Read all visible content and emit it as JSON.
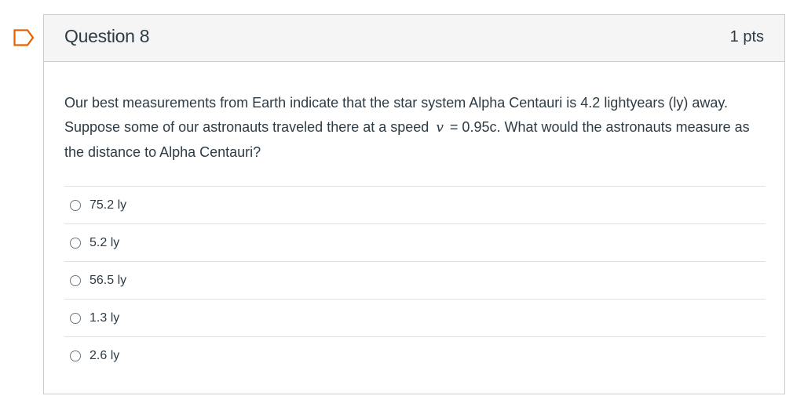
{
  "question": {
    "title": "Question 8",
    "points": "1 pts",
    "text_part1": "Our best measurements from Earth indicate that the star system Alpha Centauri is 4.2 lightyears (ly) away. Suppose some of our astronauts traveled there at a speed",
    "variable": "v",
    "text_part2": "= 0.95c. What would the astronauts measure as the distance to Alpha Centauri?",
    "flag_icon": "flag-bookmark-icon",
    "answers": [
      {
        "label": "75.2 ly",
        "selected": false
      },
      {
        "label": "5.2 ly",
        "selected": false
      },
      {
        "label": "56.5 ly",
        "selected": false
      },
      {
        "label": "1.3 ly",
        "selected": false
      },
      {
        "label": "2.6 ly",
        "selected": false
      }
    ]
  },
  "colors": {
    "accent": "#e66000",
    "header_bg": "#f5f5f5",
    "border": "#c7cdd1",
    "text": "#2d3b45"
  }
}
